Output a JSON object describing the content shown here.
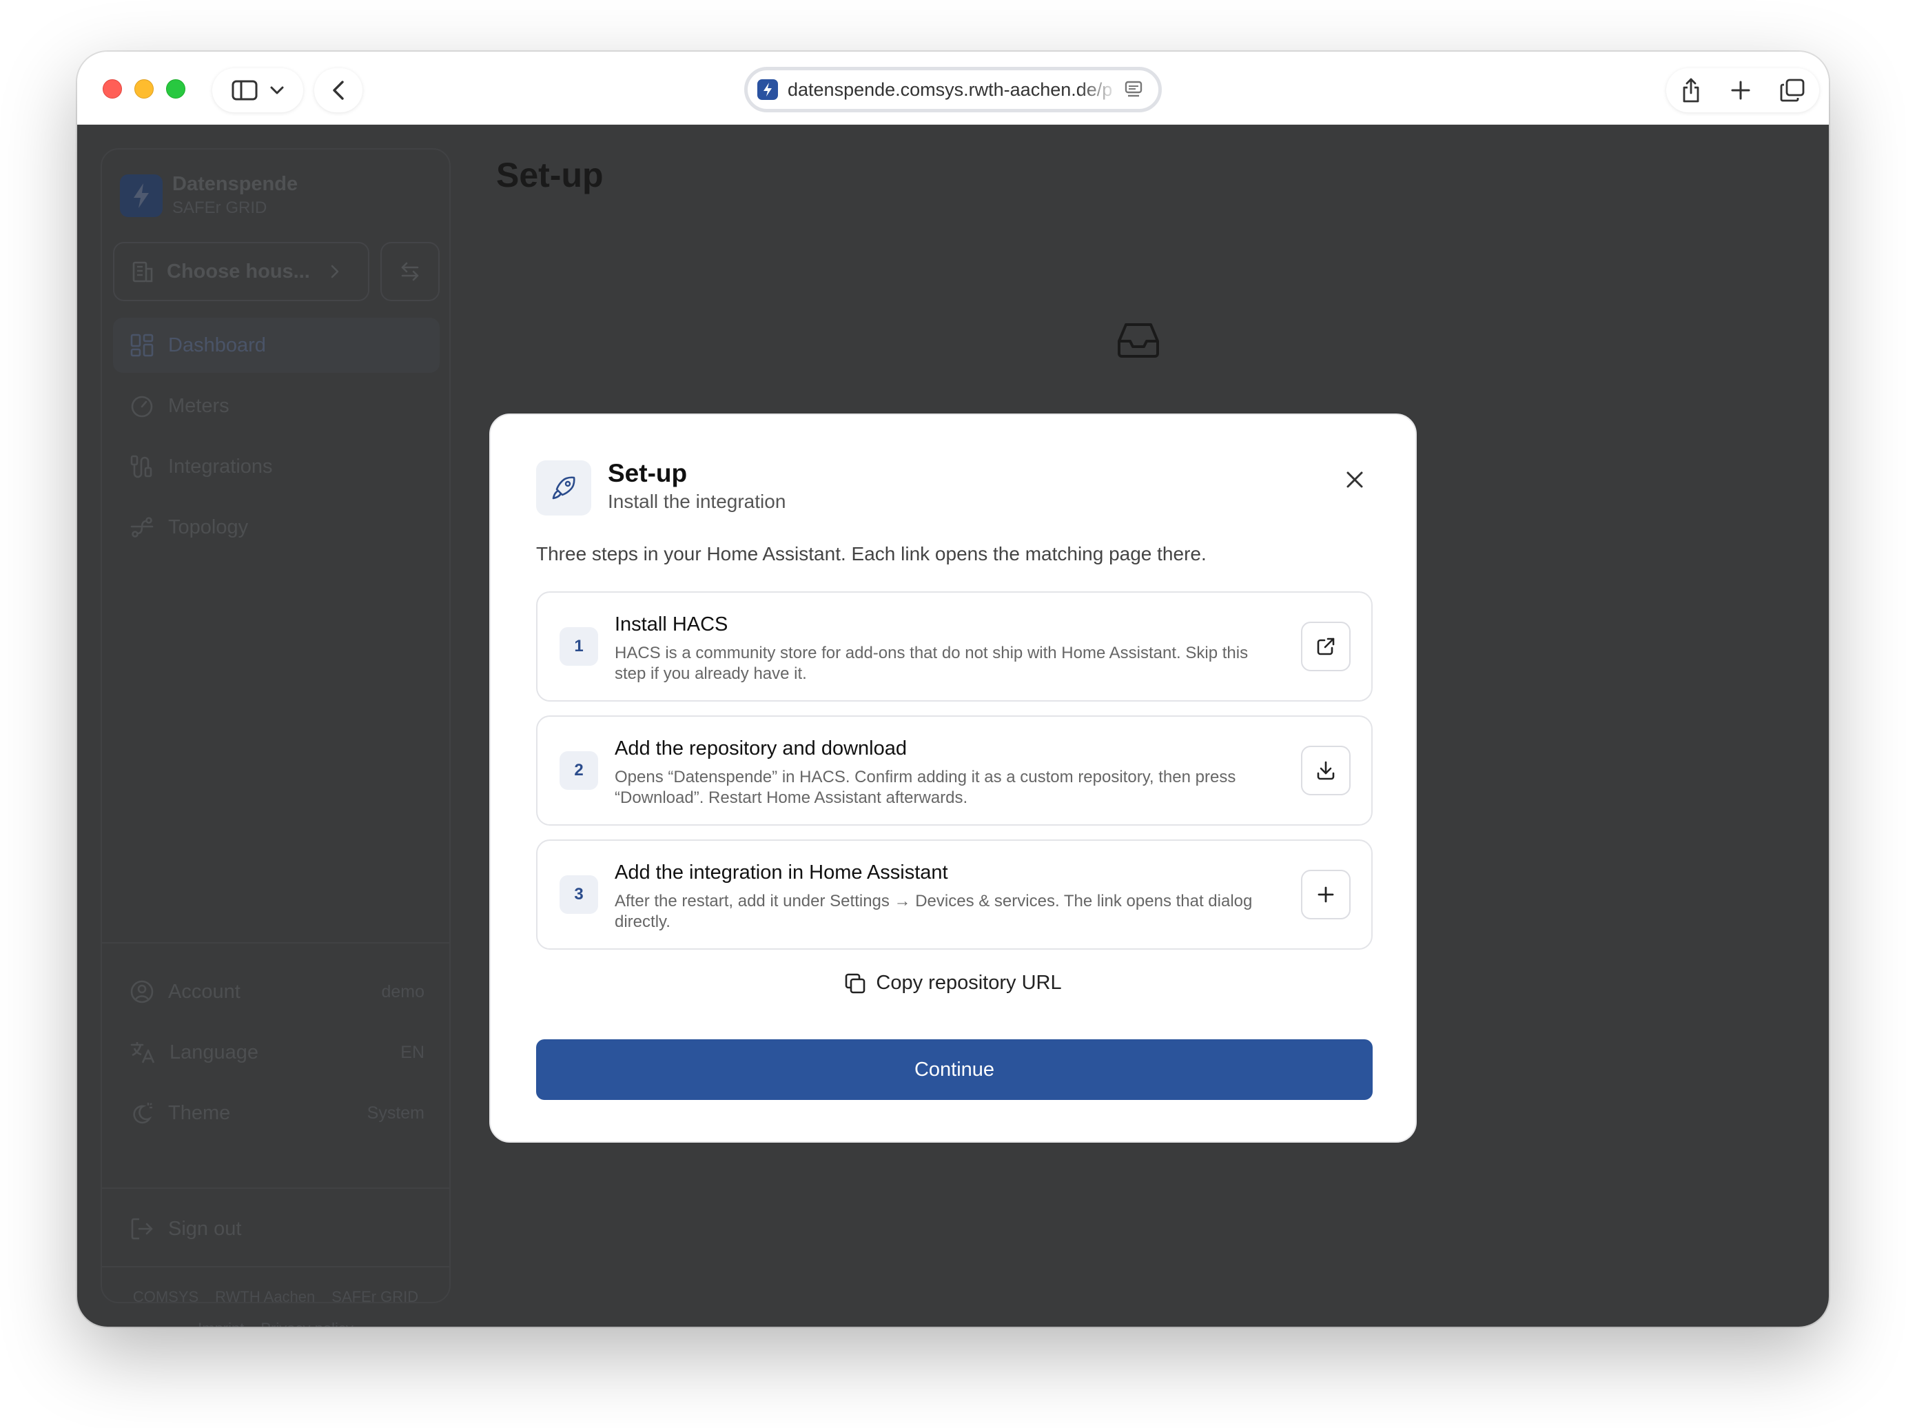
{
  "browser": {
    "url": "datenspende.comsys.rwth-aachen.de/p"
  },
  "sidebar": {
    "brand_name": "Datenspende",
    "brand_sub": "SAFEr GRID",
    "choose_label": "Choose hous...",
    "nav": [
      {
        "label": "Dashboard",
        "icon": "dashboard-icon"
      },
      {
        "label": "Meters",
        "icon": "gauge-icon"
      },
      {
        "label": "Integrations",
        "icon": "integrations-icon"
      },
      {
        "label": "Topology",
        "icon": "topology-icon"
      }
    ],
    "settings": [
      {
        "label": "Account",
        "value": "demo",
        "icon": "user-circle-icon"
      },
      {
        "label": "Language",
        "value": "EN",
        "icon": "translate-icon"
      },
      {
        "label": "Theme",
        "value": "System",
        "icon": "theme-icon"
      }
    ],
    "signout": "Sign out",
    "footer_links": [
      "COMSYS",
      "RWTH Aachen",
      "SAFEr GRID"
    ],
    "footer_legal": [
      "Imprint",
      "Privacy policy"
    ]
  },
  "main": {
    "title": "Set-up"
  },
  "modal": {
    "title": "Set-up",
    "subtitle": "Install the integration",
    "intro": "Three steps in your Home Assistant. Each link opens the matching page there.",
    "steps": [
      {
        "num": "1",
        "title": "Install HACS",
        "desc": "HACS is a community store for add-ons that do not ship with Home Assistant. Skip this step if you already have it.",
        "action_icon": "external-link-icon"
      },
      {
        "num": "2",
        "title": "Add the repository and download",
        "desc": "Opens “Datenspende” in HACS. Confirm adding it as a custom repository, then press “Download”. Restart Home Assistant afterwards.",
        "action_icon": "download-icon"
      },
      {
        "num": "3",
        "title": "Add the integration in Home Assistant",
        "desc": "After the restart, add it under Settings → Devices & services. The link opens that dialog directly.",
        "action_icon": "plus-icon"
      }
    ],
    "copy_label": "Copy repository URL",
    "continue_label": "Continue"
  },
  "colors": {
    "accent": "#2b549b",
    "overlay": "#3a3b3c"
  }
}
